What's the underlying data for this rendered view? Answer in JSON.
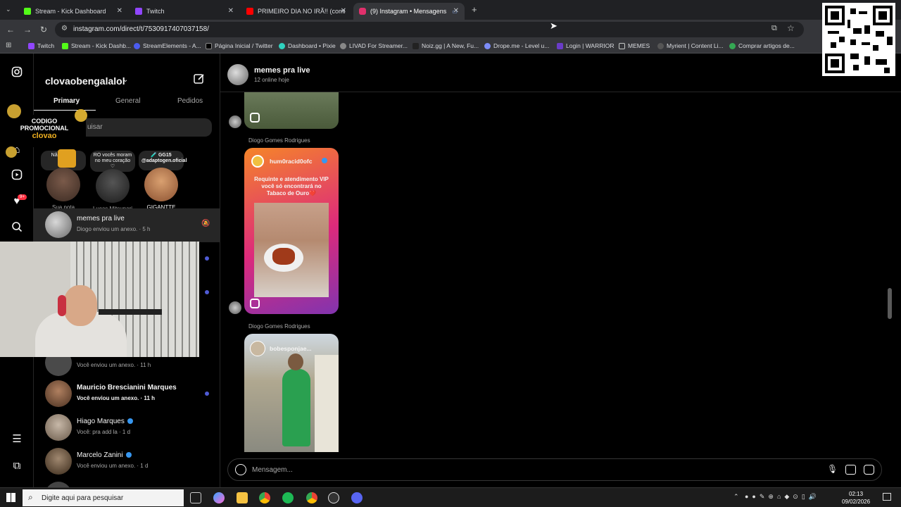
{
  "browser": {
    "tabs": [
      {
        "title": "Stream - Kick Dashboard",
        "color": "#53fc18"
      },
      {
        "title": "Twitch",
        "color": "#9146ff"
      },
      {
        "title": "PRIMEIRO DIA NO IRÃ!! (comid",
        "color": "#ff0000"
      },
      {
        "title": "(9) Instagram • Mensagens",
        "color": "#e1306c"
      }
    ],
    "new_tab": "+",
    "url": "instagram.com/direct/t/7530917407037158/",
    "bookmarks": [
      "Twitch",
      "Stream - Kick Dashb...",
      "StreamElements - A...",
      "Página Inicial / Twitter",
      "Dashboard • Pixie",
      "LIVAD For Streamer...",
      "Noiz.gg | A New, Fu...",
      "Drope.me - Level u...",
      "Login | WARRIOR",
      "MEMES",
      "Myrient | Content Li...",
      "Comprar artigos de..."
    ]
  },
  "inbox": {
    "username": "clovaobengalalol",
    "tabs": [
      "Primary",
      "General",
      "Pedidos"
    ],
    "search_placeholder": "uisar",
    "notes": [
      {
        "text": "Não... hora",
        "name": "Sua nota"
      },
      {
        "text": "RO vocês moram no meu coração ♡",
        "name": "Lucas Mitsunari"
      },
      {
        "text": "🧪 GG15 @adaptogen.oficial",
        "name": "GIGANTTE"
      }
    ],
    "conversations": [
      {
        "name": "memes pra live",
        "sub": "Diogo enviou um anexo. · 5 h"
      },
      {
        "name": "",
        "sub": "Você enviou um anexo. · 11 h"
      },
      {
        "name": "Mauricio Brescianini Marques",
        "sub": "Você enviou um anexo. · 11 h"
      },
      {
        "name": "Hiago Marques",
        "sub": "Você: pra add la · 1 d"
      },
      {
        "name": "Marcelo Zanini",
        "sub": "Você enviou um anexo. · 1 d"
      }
    ],
    "rail_badge": "9+"
  },
  "promo": {
    "line1": "CODIGO",
    "line2": "PROMOCIONAL",
    "code": "clovao"
  },
  "chat": {
    "title": "memes pra live",
    "status": "12 online hoje",
    "messages": [
      {
        "sender": "Diogo Gomes Rodrigues",
        "handle": "hum0racid0ofc",
        "caption": "Requinte e atendimento VIP você só encontrará no Tabaco de Ouro❤️"
      },
      {
        "sender": "Diogo Gomes Rodrigues",
        "handle": "bobesponjae..."
      }
    ],
    "composer_placeholder": "Mensagem..."
  },
  "taskbar": {
    "search": "Digite aqui para pesquisar",
    "time": "02:13",
    "date": "09/02/2026"
  }
}
